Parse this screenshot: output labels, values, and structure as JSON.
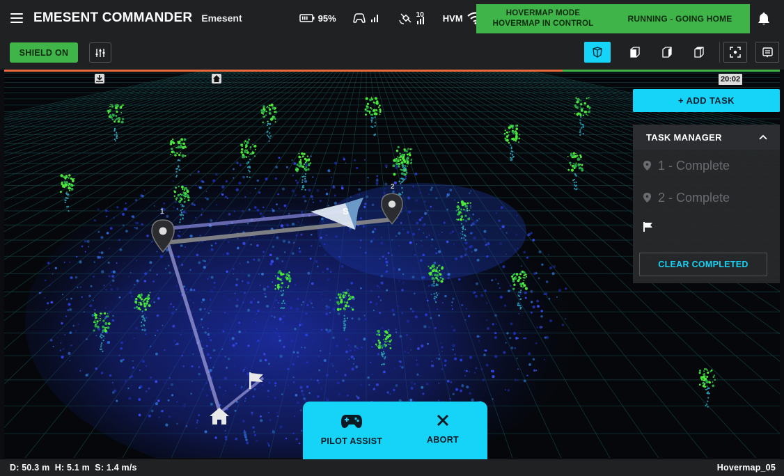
{
  "header": {
    "app_title": "EMESENT COMMANDER",
    "org_name": "Emesent",
    "battery": "95%",
    "satellites": "10",
    "hvm_label": "HVM",
    "mode_line1": "HOVERMAP MODE",
    "mode_line2": "HOVERMAP IN CONTROL",
    "run_status": "RUNNING - GOING HOME",
    "status_color": "#3fb448"
  },
  "toolbar": {
    "shield_label": "SHIELD ON",
    "view_buttons": [
      "perspective-view-icon",
      "front-view-icon",
      "side-view-icon",
      "top-view-icon"
    ],
    "active_view": "perspective-view-icon",
    "accent": "#16d4f8"
  },
  "mission": {
    "progress": 0.72,
    "timer": "20:02",
    "waypoint_1": "1",
    "waypoint_2": "2"
  },
  "task_manager": {
    "add_label": "+ ADD TASK",
    "title": "TASK MANAGER",
    "tasks": [
      {
        "label": "1 - Complete"
      },
      {
        "label": "2 - Complete"
      }
    ],
    "clear_label": "CLEAR COMPLETED"
  },
  "actions": {
    "pilot_assist": "PILOT ASSIST",
    "abort": "ABORT"
  },
  "footer": {
    "telemetry": "D: 50.3 m  H: 5.1 m  S: 1.4 m/s",
    "device": "Hovermap_05"
  }
}
